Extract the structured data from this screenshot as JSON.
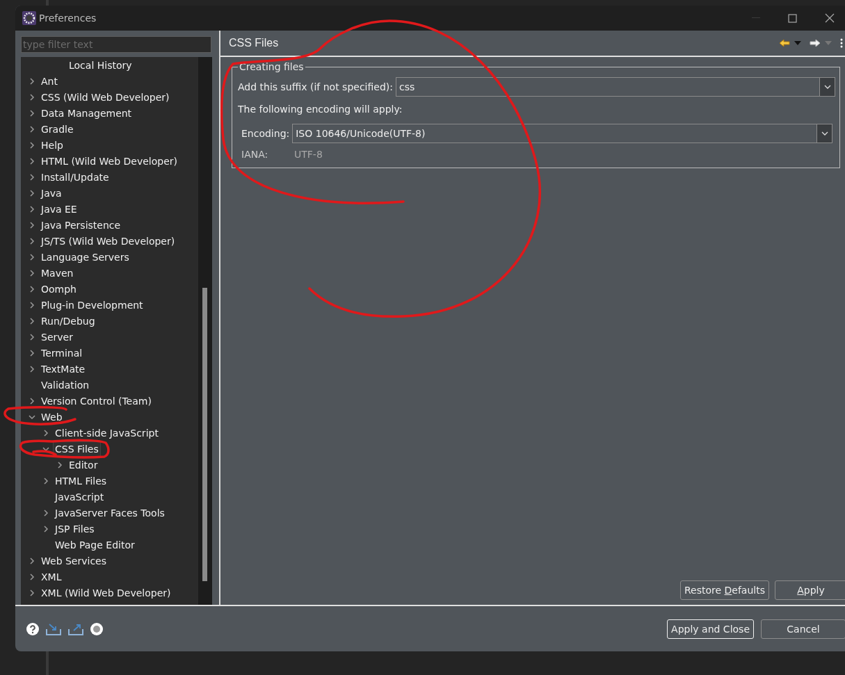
{
  "window": {
    "title": "Preferences"
  },
  "filter": {
    "placeholder": "type filter text"
  },
  "tree": [
    {
      "kind": "offscreen",
      "children": [
        {
          "kind": "offscreen",
          "children": [
            {
              "label": "Local History",
              "selected": false
            }
          ]
        }
      ]
    },
    {
      "label": "Ant",
      "expanded": false,
      "selected": false
    },
    {
      "label": "CSS (Wild Web Developer)",
      "expanded": false,
      "selected": false
    },
    {
      "label": "Data Management",
      "expanded": false,
      "selected": false
    },
    {
      "label": "Gradle",
      "expanded": false,
      "selected": false
    },
    {
      "label": "Help",
      "expanded": false,
      "selected": false
    },
    {
      "label": "HTML (Wild Web Developer)",
      "expanded": false,
      "selected": false
    },
    {
      "label": "Install/Update",
      "expanded": false,
      "selected": false
    },
    {
      "label": "Java",
      "expanded": false,
      "selected": false
    },
    {
      "label": "Java EE",
      "expanded": false,
      "selected": false
    },
    {
      "label": "Java Persistence",
      "expanded": false,
      "selected": false
    },
    {
      "label": "JS/TS (Wild Web Developer)",
      "expanded": false,
      "selected": false
    },
    {
      "label": "Language Servers",
      "expanded": false,
      "selected": false
    },
    {
      "label": "Maven",
      "expanded": false,
      "selected": false
    },
    {
      "label": "Oomph",
      "expanded": false,
      "selected": false
    },
    {
      "label": "Plug-in Development",
      "expanded": false,
      "selected": false
    },
    {
      "label": "Run/Debug",
      "expanded": false,
      "selected": false
    },
    {
      "label": "Server",
      "expanded": false,
      "selected": false
    },
    {
      "label": "Terminal",
      "expanded": false,
      "selected": false
    },
    {
      "label": "TextMate",
      "expanded": false,
      "selected": false
    },
    {
      "label": "Validation",
      "selected": false
    },
    {
      "label": "Version Control (Team)",
      "expanded": false,
      "selected": false
    },
    {
      "label": "Web",
      "expanded": true,
      "selected": false,
      "children": [
        {
          "label": "Client-side JavaScript",
          "expanded": false,
          "selected": false
        },
        {
          "label": "CSS Files",
          "expanded": true,
          "selected": true,
          "children": [
            {
              "label": "Editor",
              "expanded": false,
              "selected": false
            }
          ]
        },
        {
          "label": "HTML Files",
          "expanded": false,
          "selected": false
        },
        {
          "label": "JavaScript",
          "selected": false
        },
        {
          "label": "JavaServer Faces Tools",
          "expanded": false,
          "selected": false
        },
        {
          "label": "JSP Files",
          "expanded": false,
          "selected": false
        },
        {
          "label": "Web Page Editor",
          "selected": false
        }
      ]
    },
    {
      "label": "Web Services",
      "expanded": false,
      "selected": false
    },
    {
      "label": "XML",
      "expanded": false,
      "selected": false
    },
    {
      "label": "XML (Wild Web Developer)",
      "expanded": false,
      "selected": false
    }
  ],
  "page": {
    "title": "CSS Files",
    "group": {
      "title": "Creating files",
      "suffix_label": "Add this suffix (if not specified):",
      "suffix_value": "css",
      "encoding_note": "The following encoding will apply:",
      "encoding_label": "Encoding:",
      "encoding_value": "ISO 10646/Unicode(UTF-8)",
      "iana_label": "IANA:",
      "iana_value": "UTF-8"
    },
    "buttons": [
      {
        "label_before": "Restore ",
        "mnemonic": "D",
        "label_after": "efaults"
      },
      {
        "mnemonic": "A",
        "label_after": "pply"
      }
    ]
  },
  "footer_buttons": [
    {
      "label": "Apply and Close",
      "default": true
    },
    {
      "label": "Cancel",
      "default": false
    }
  ]
}
